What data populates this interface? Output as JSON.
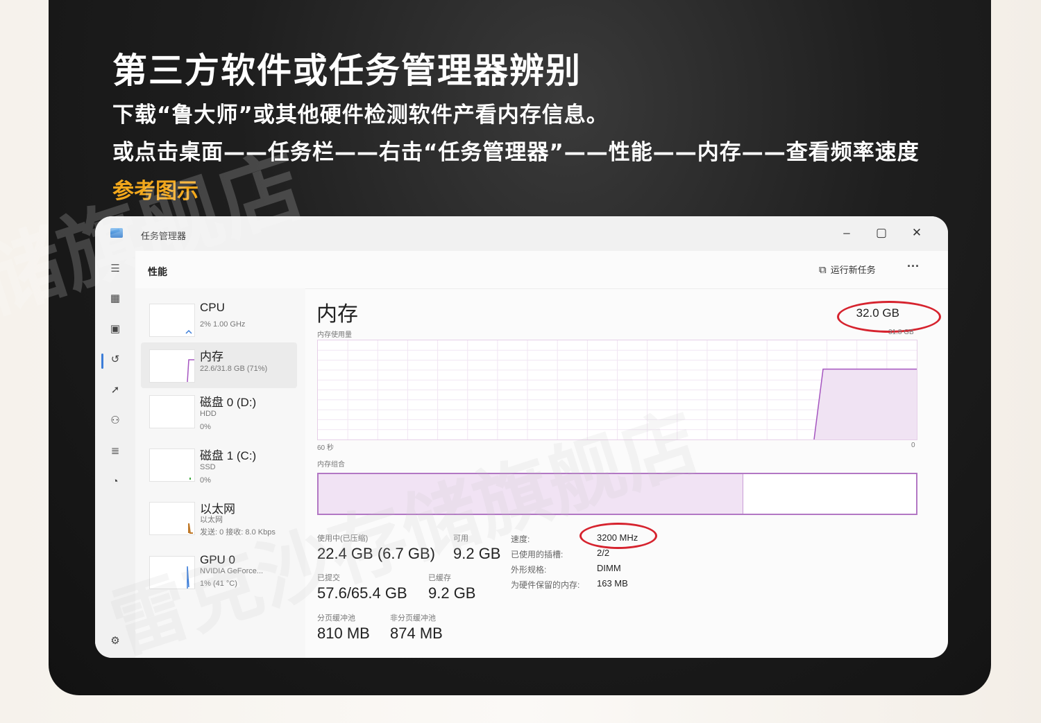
{
  "heading": "第三方软件或任务管理器辨别",
  "line1": "下载“鲁大师”或其他硬件检测软件产看内存信息。",
  "line2": "或点击桌面——任务栏——右击“任务管理器”——性能——内存——查看频率速度",
  "reference_label": "参考图示",
  "watermark": "储旗舰店",
  "watermark2": "雷克沙存储旗舰店",
  "task_manager": {
    "app_title": "任务管理器",
    "page_title": "性能",
    "run_new_task": "运行新任务",
    "more": "···",
    "window_controls": {
      "minimize": "–",
      "maximize": "▢",
      "close": "✕"
    },
    "sidebar_items": [
      {
        "name": "CPU",
        "sub1": "2% 1.00 GHz",
        "sub2": "",
        "sub3": ""
      },
      {
        "name": "内存",
        "sub1": "22.6/31.8 GB (71%)",
        "sub2": "",
        "sub3": ""
      },
      {
        "name": "磁盘 0 (D:)",
        "sub1": "HDD",
        "sub2": "0%",
        "sub3": ""
      },
      {
        "name": "磁盘 1 (C:)",
        "sub1": "SSD",
        "sub2": "0%",
        "sub3": ""
      },
      {
        "name": "以太网",
        "sub1": "以太网",
        "sub2": "发送: 0 接收: 8.0 Kbps",
        "sub3": ""
      },
      {
        "name": "GPU 0",
        "sub1": "NVIDIA GeForce...",
        "sub2": "1% (41 °C)",
        "sub3": ""
      }
    ],
    "memory": {
      "title": "内存",
      "total": "32.0 GB",
      "usage_label": "内存使用量",
      "usage_max": "31.8 GB",
      "time_left": "60 秒",
      "time_right": "0",
      "composition_label": "内存组合",
      "composition_used_fraction": 0.71,
      "usage_series_fraction": 0.71,
      "stats": {
        "in_use_label": "使用中(已压缩)",
        "in_use_value": "22.4 GB (6.7 GB)",
        "available_label": "可用",
        "available_value": "9.2 GB",
        "committed_label": "已提交",
        "committed_value": "57.6/65.4 GB",
        "cached_label": "已缓存",
        "cached_value": "9.2 GB",
        "paged_pool_label": "分页缓冲池",
        "paged_pool_value": "810 MB",
        "nonpaged_pool_label": "非分页缓冲池",
        "nonpaged_pool_value": "874 MB"
      },
      "specs": {
        "speed_label": "速度:",
        "speed_value": "3200 MHz",
        "slots_label": "已使用的插槽:",
        "slots_value": "2/2",
        "form_label": "外形规格:",
        "form_value": "DIMM",
        "reserved_label": "为硬件保留的内存:",
        "reserved_value": "163 MB"
      }
    }
  },
  "colors": {
    "accent_orange": "#f3a81c",
    "highlight_red": "#d6232e",
    "memory_purple": "#b277c4"
  }
}
